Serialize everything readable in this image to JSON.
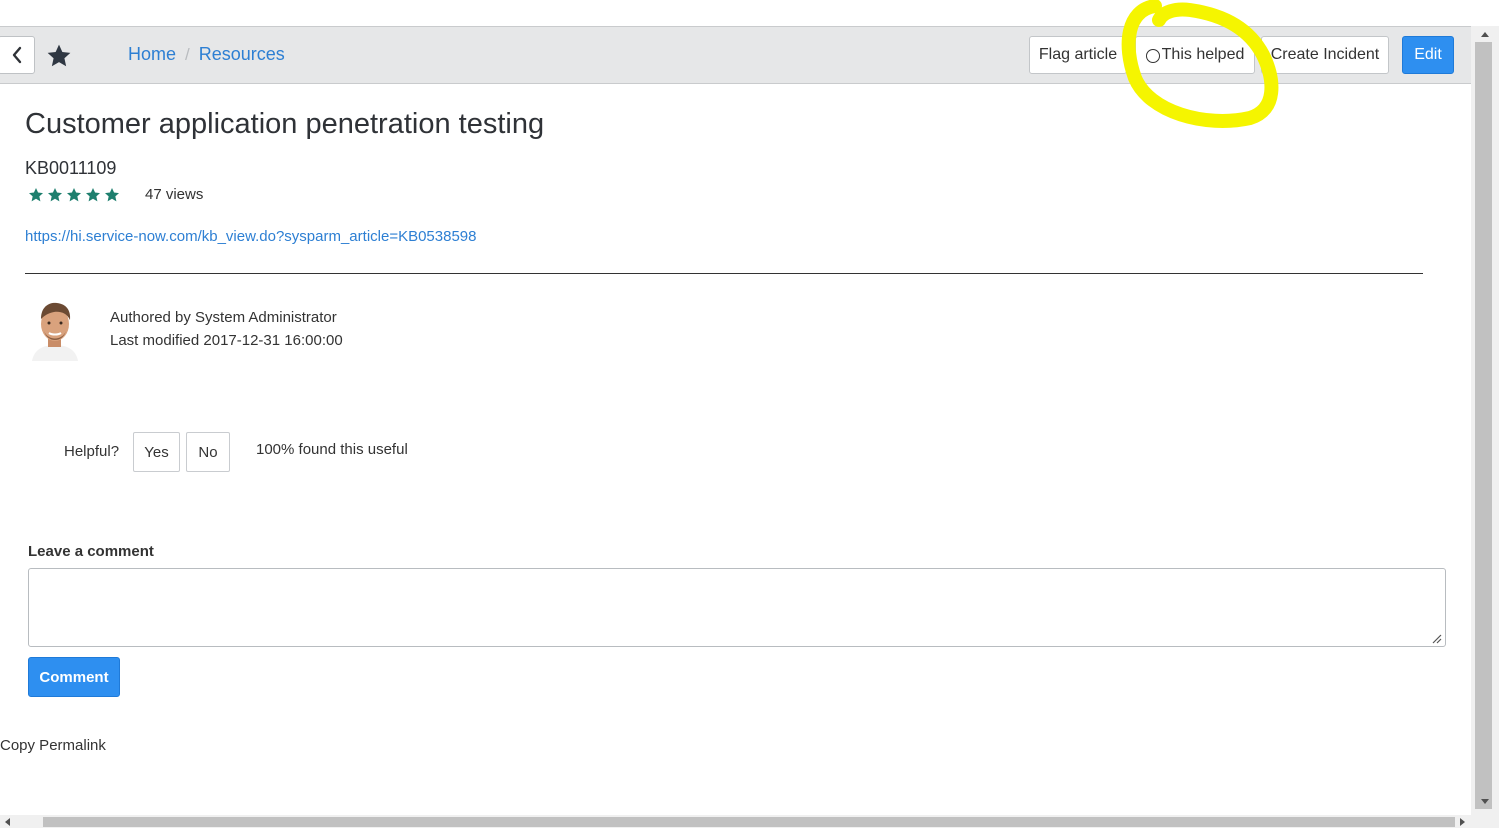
{
  "colors": {
    "accent": "#2e8ff0",
    "link": "#2d7fd3",
    "star": "#1e7f6e",
    "highlight": "#f5f500"
  },
  "header": {
    "back_icon": "chevron-left-icon",
    "favorite_icon": "star-icon",
    "breadcrumb": [
      {
        "label": "Home"
      },
      {
        "label": "Resources"
      }
    ],
    "separator": "/",
    "actions": {
      "flag_label": "Flag article",
      "helped_label": "This helped",
      "incident_label": "Create Incident",
      "edit_label": "Edit"
    }
  },
  "article": {
    "title": "Customer application penetration testing",
    "number": "KB0011109",
    "rating": 5,
    "views": "47 views",
    "link": "https://hi.service-now.com/kb_view.do?sysparm_article=KB0538598",
    "author": "Authored by System Administrator",
    "modified": "Last modified 2017-12-31 16:00:00"
  },
  "feedback": {
    "question": "Helpful?",
    "yes_label": "Yes",
    "no_label": "No",
    "summary": "100% found this useful"
  },
  "comment": {
    "label": "Leave a comment",
    "value": "",
    "button_label": "Comment"
  },
  "footer": {
    "permalink_label": "Copy Permalink"
  }
}
